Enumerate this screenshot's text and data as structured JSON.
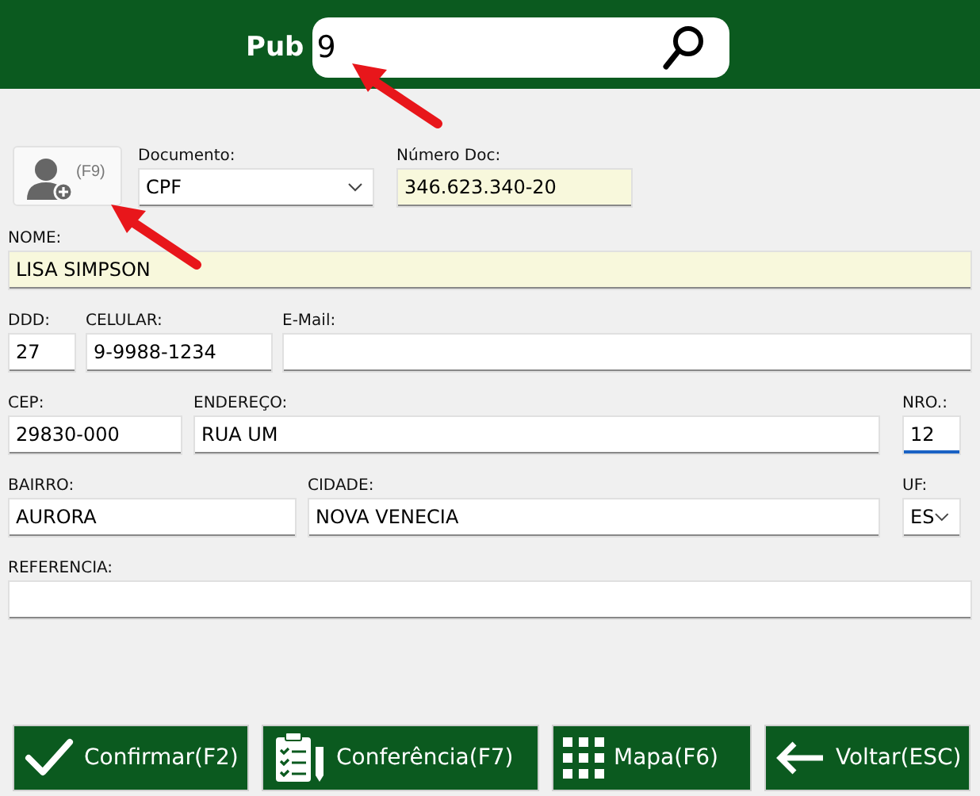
{
  "header": {
    "label": "Pub",
    "search": {
      "value": "9"
    }
  },
  "avatar_button": {
    "shortcut": "(F9)"
  },
  "rows": [
    [
      {
        "label": "Documento:",
        "value": "CPF",
        "kind": "select",
        "highlighted": false,
        "focused": false
      },
      {
        "label": "Número Doc:",
        "value": "346.623.340-20",
        "kind": "input",
        "highlighted": true,
        "focused": false
      }
    ],
    [
      {
        "label": "NOME:",
        "value": "LISA SIMPSON",
        "kind": "input",
        "highlighted": true,
        "focused": false
      }
    ],
    [
      {
        "label": "DDD:",
        "value": "27",
        "kind": "input",
        "highlighted": false,
        "focused": false
      },
      {
        "label": "CELULAR:",
        "value": "9-9988-1234",
        "kind": "input",
        "highlighted": false,
        "focused": false
      },
      {
        "label": "E-Mail:",
        "kind": "input",
        "highlighted": false,
        "focused": false
      }
    ],
    [
      {
        "label": "CEP:",
        "value": "29830-000",
        "kind": "input",
        "highlighted": false,
        "focused": false
      },
      {
        "label": "ENDEREÇO:",
        "value": "RUA UM",
        "kind": "input",
        "highlighted": false,
        "focused": false
      },
      {
        "label": "NRO.:",
        "value": "12",
        "kind": "input",
        "highlighted": false,
        "focused": true
      }
    ],
    [
      {
        "label": "BAIRRO:",
        "value": "AURORA",
        "kind": "input",
        "highlighted": false,
        "focused": false
      },
      {
        "label": "CIDADE:",
        "value": "NOVA VENECIA",
        "kind": "input",
        "highlighted": false,
        "focused": false
      },
      {
        "label": "UF:",
        "value": "ES",
        "kind": "select",
        "highlighted": false,
        "focused": false
      }
    ],
    [
      {
        "label": "REFERENCIA:",
        "kind": "input",
        "highlighted": false,
        "focused": false
      }
    ]
  ],
  "buttons": [
    {
      "label": "Confirmar(F2)",
      "kind": "confirm"
    },
    {
      "label": "Conferência(F7)",
      "kind": "checklist"
    },
    {
      "label": "Mapa(F6)",
      "kind": "map"
    },
    {
      "label": "Voltar(ESC)",
      "kind": "back"
    }
  ]
}
